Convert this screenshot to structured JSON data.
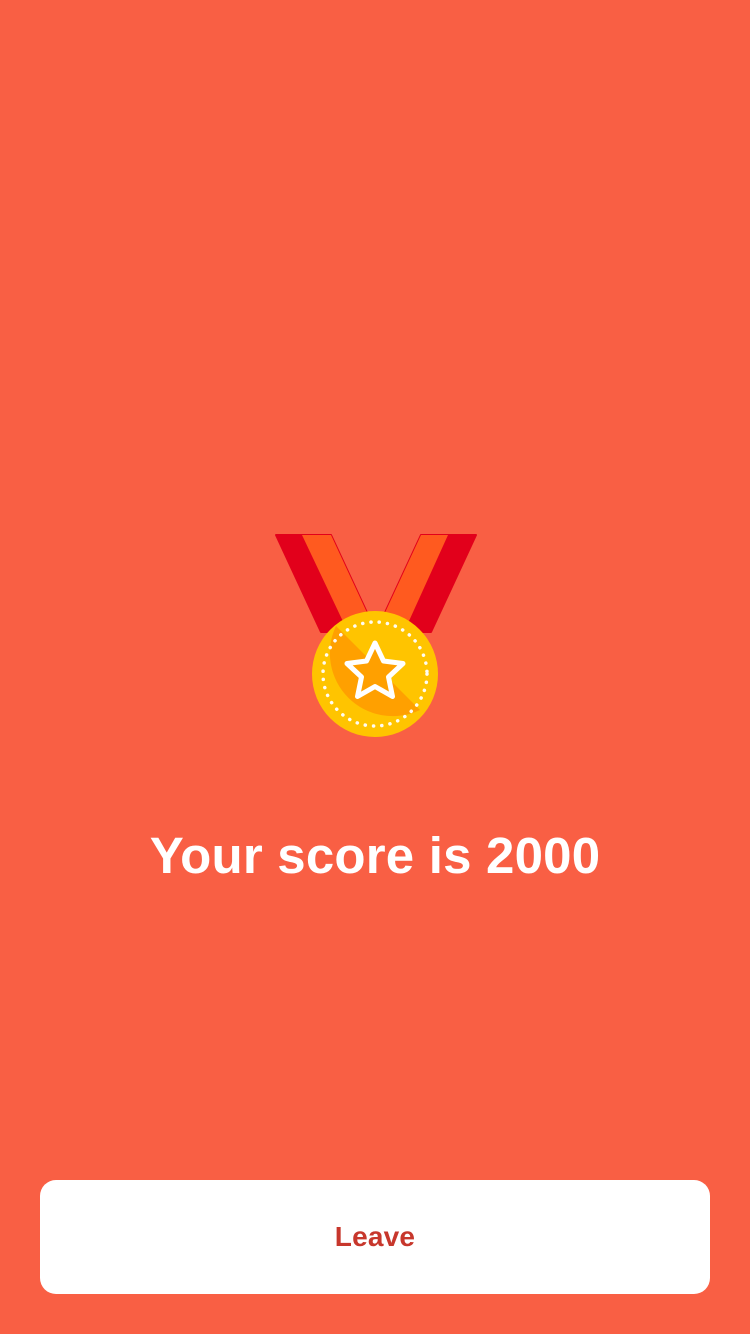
{
  "screen": {
    "background_color": "#F95F44"
  },
  "medal": {
    "icon": "medal-icon",
    "ribbon_dark_color": "#E2001B",
    "ribbon_light_color": "#FF5A1F",
    "coin_color": "#FFC400",
    "coin_shade_color": "#FFA000",
    "star_color": "#FFA000",
    "accent_color": "#FFFFFF"
  },
  "result": {
    "score_text": "Your score is 2000"
  },
  "actions": {
    "leave_label": "Leave",
    "leave_text_color": "#C7372C",
    "leave_background": "#FFFFFF"
  }
}
